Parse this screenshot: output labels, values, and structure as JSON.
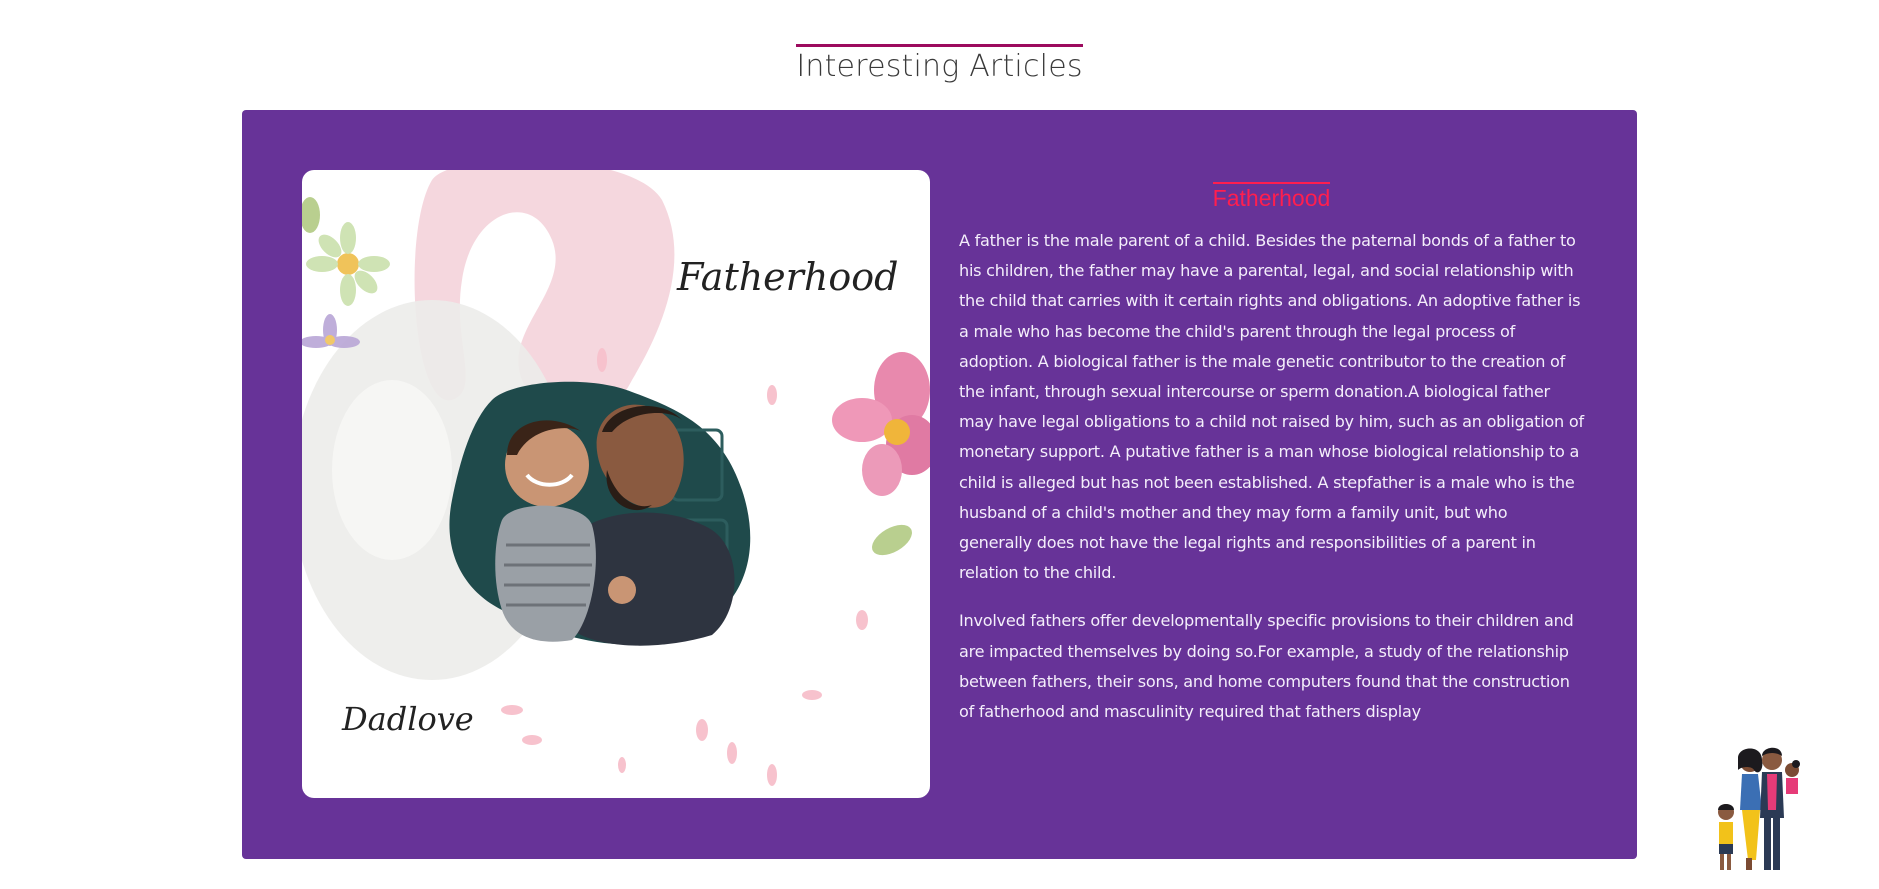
{
  "section": {
    "title": "Interesting Articles"
  },
  "image_card": {
    "script_title": "Fatherhood",
    "script_caption": "Dadlove"
  },
  "article": {
    "title": "Fatherhood",
    "paragraphs": [
      "A father is the male parent of a child. Besides the paternal bonds of a father to his children, the father may have a parental, legal, and social relationship with the child that carries with it certain rights and obligations. An adoptive father is a male who has become the child's parent through the legal process of adoption. A biological father is the male genetic contributor to the creation of the infant, through sexual intercourse or sperm donation.A biological father may have legal obligations to a child not raised by him, such as an obligation of monetary support. A putative father is a man whose biological relationship to a child is alleged but has not been established. A stepfather is a male who is the husband of a child's mother and they may form a family unit, but who generally does not have the legal rights and responsibilities of a parent in relation to the child.",
      "Involved fathers offer developmentally specific provisions to their children and are impacted themselves by doing so.For example, a study of the relationship between fathers, their sons, and home computers found that the construction of fatherhood and masculinity required that fathers display"
    ]
  },
  "colors": {
    "card_background": "#673398",
    "heading_underline": "#9c0a5e",
    "article_title": "#ff1e4e"
  },
  "icons": {
    "mascot": "family-illustration-icon"
  }
}
